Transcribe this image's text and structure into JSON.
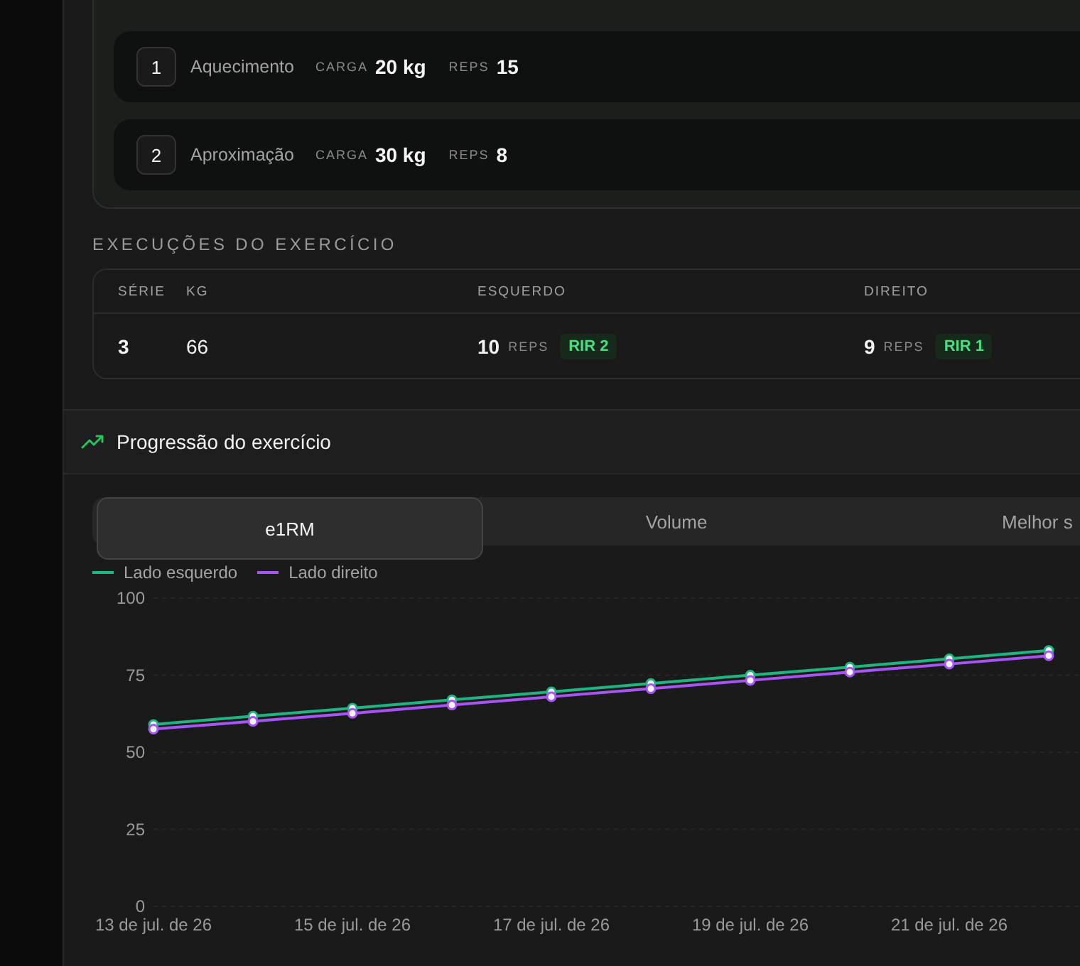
{
  "warmup_sets": [
    {
      "index": "1",
      "name": "Aquecimento",
      "load_label": "CARGA",
      "load": "20 kg",
      "reps_label": "REPS",
      "reps": "15"
    },
    {
      "index": "2",
      "name": "Aproximação",
      "load_label": "CARGA",
      "load": "30 kg",
      "reps_label": "REPS",
      "reps": "8"
    }
  ],
  "executions": {
    "title": "EXECUÇÕES DO EXERCÍCIO",
    "columns": [
      "SÉRIE",
      "KG",
      "ESQUERDO",
      "DIREITO"
    ],
    "rows": [
      {
        "serie": "3",
        "kg": "66",
        "left": {
          "reps": "10",
          "reps_label": "REPS",
          "rir": "RIR 2"
        },
        "right": {
          "reps": "9",
          "reps_label": "REPS",
          "rir": "RIR 1"
        }
      }
    ]
  },
  "progression": {
    "title": "Progressão do exercício",
    "tabs": [
      {
        "label": "e1RM",
        "selected": true
      },
      {
        "label": "Volume",
        "selected": false
      },
      {
        "label": "Melhor s",
        "selected": false
      }
    ],
    "chart_data": {
      "type": "line",
      "categories": [
        "13 de jul. de 26",
        null,
        "15 de jul. de 26",
        null,
        "17 de jul. de 26",
        null,
        "19 de jul. de 26",
        null,
        "21 de jul. de 26",
        null
      ],
      "series": [
        {
          "name": "Lado esquerdo",
          "color": "#1fb583",
          "marker": "circle",
          "values": [
            59,
            61.7,
            64.3,
            67,
            69.6,
            72.3,
            75,
            77.6,
            80.3,
            83
          ]
        },
        {
          "name": "Lado direito",
          "color": "#a855f7",
          "marker": "circle",
          "values": [
            57.5,
            60,
            62.6,
            65.3,
            68,
            70.6,
            73.3,
            76,
            78.6,
            81.3
          ]
        }
      ],
      "ylim": [
        0,
        100
      ],
      "yticks": [
        0,
        25,
        50,
        75,
        100
      ],
      "grid": true
    }
  }
}
